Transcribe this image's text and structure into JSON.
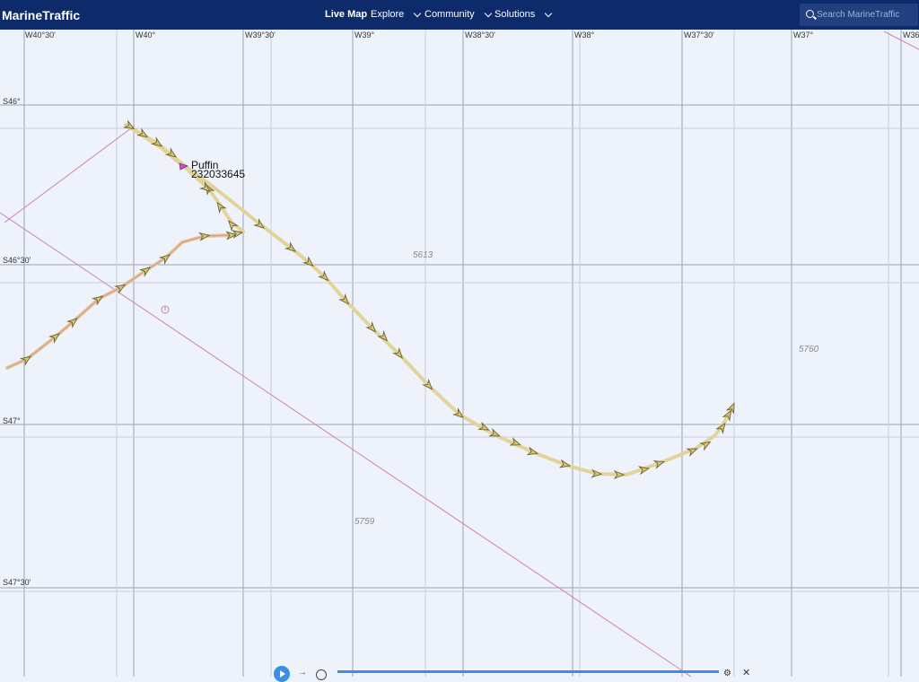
{
  "header": {
    "brand": "MarineTraffic",
    "nav": [
      {
        "label": "Live Map",
        "dropdown": false
      },
      {
        "label": "Explore",
        "dropdown": true
      },
      {
        "label": "Community",
        "dropdown": true
      },
      {
        "label": "Solutions",
        "dropdown": true
      }
    ],
    "search_placeholder": "Search MarineTraffic"
  },
  "map": {
    "longitude_labels": [
      "W40°30'",
      "W40°",
      "W39°30'",
      "W39°",
      "W38°30'",
      "W38°",
      "W37°30'",
      "W37°",
      "W36"
    ],
    "latitude_labels": [
      "S46°",
      "S46°30'",
      "S47°",
      "S47°30'"
    ],
    "depth_soundings": [
      "5613",
      "5760",
      "5759"
    ],
    "vessel": {
      "name": "Puffin",
      "mmsi": "232033645"
    },
    "track_color": "#e2d39a",
    "track_arrow_color": "#6b6332",
    "boundary_color": "#cc7fbd"
  },
  "playback": {
    "controls": [
      "play-icon",
      "arrow-right-icon",
      "clock-icon",
      "gear-icon",
      "close-icon"
    ],
    "timeline_color": "#3a8ee6"
  }
}
